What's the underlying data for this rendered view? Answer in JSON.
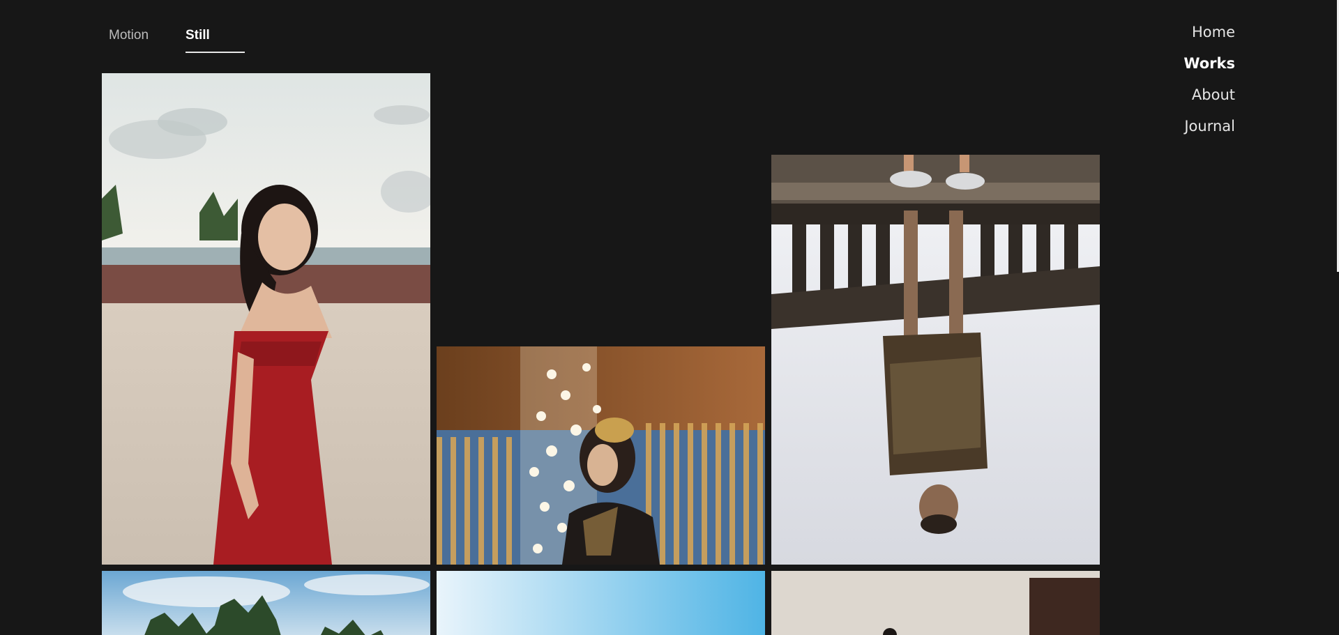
{
  "tabs": {
    "motion_label": "Motion",
    "still_label": "Still",
    "active": "Still"
  },
  "nav": {
    "items": [
      {
        "label": "Home"
      },
      {
        "label": "Works"
      },
      {
        "label": "About"
      },
      {
        "label": "Journal"
      }
    ],
    "active": "Works"
  },
  "gallery": {
    "photos": [
      {
        "subject": "woman in red dress on beach",
        "colors": [
          "#e9eceb",
          "#a81d22",
          "#cdbfae"
        ]
      },
      {
        "subject": "woman with headpiece under chandelier",
        "colors": [
          "#8a5a2b",
          "#f4efe0",
          "#2a2220"
        ]
      },
      {
        "subject": "reflection of person in puddle",
        "colors": [
          "#e7e9ee",
          "#3c3124",
          "#6b5a44"
        ]
      },
      {
        "subject": "palm trees under sky",
        "colors": [
          "#7fb1d6",
          "#274b27",
          "#e6eef3"
        ]
      },
      {
        "subject": "blue sky",
        "colors": [
          "#d4ebf8",
          "#5ab8e6"
        ]
      },
      {
        "subject": "two people indoors",
        "colors": [
          "#ddd7cf",
          "#2a2320",
          "#4a2c22"
        ]
      }
    ]
  }
}
